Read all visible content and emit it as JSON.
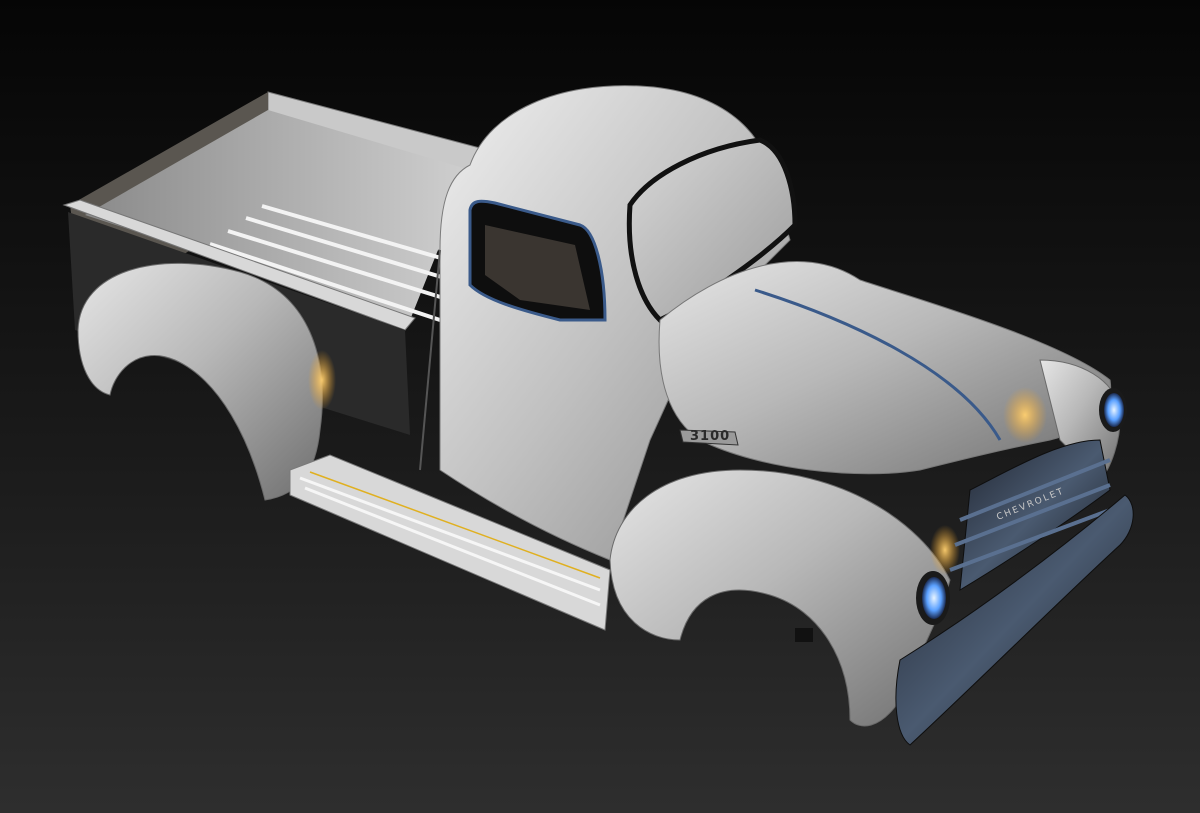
{
  "scene": {
    "subject": "pickup-truck-3d-render",
    "background_top": "#050505",
    "background_bottom": "#2e2e2e",
    "body_color": "#b9b9b9",
    "trim_color": "#3a5a8a",
    "highlight_color": "#f0a020"
  },
  "badges": {
    "fender_badge": "3100",
    "grille_badge": "CHEVROLET"
  }
}
